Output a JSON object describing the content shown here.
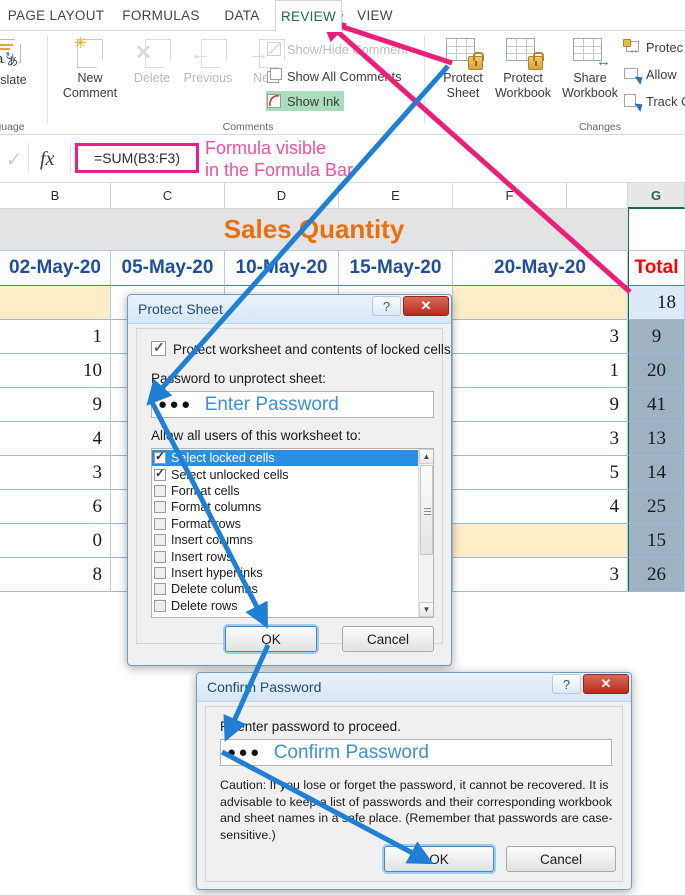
{
  "ribbon": {
    "tabs": [
      {
        "label": "PAGE LAYOUT",
        "active": false
      },
      {
        "label": "FORMULAS",
        "active": false
      },
      {
        "label": "DATA",
        "active": false
      },
      {
        "label": "REVIEW",
        "active": true
      },
      {
        "label": "VIEW",
        "active": false
      }
    ],
    "groups": {
      "language": {
        "label": "guage",
        "full_label": "Language"
      },
      "comments": {
        "label": "Comments"
      },
      "changes": {
        "label": "Changes"
      }
    },
    "language_buttons": [
      {
        "label": "nslate",
        "full_label": "Translate",
        "icon": "translate-icon",
        "disabled": false
      }
    ],
    "comment_buttons": [
      {
        "label": "New",
        "label2": "Comment",
        "icon": "new-comment-icon",
        "disabled": false
      },
      {
        "label": "Delete",
        "icon": "delete-comment-icon",
        "disabled": true
      },
      {
        "label": "Previous",
        "icon": "previous-comment-icon",
        "disabled": true
      },
      {
        "label": "Next",
        "icon": "next-comment-icon",
        "disabled": true
      }
    ],
    "comment_commands": [
      {
        "label": "Show/Hide Comment",
        "icon": "show-hide-comment-icon",
        "disabled": true,
        "highlight": false
      },
      {
        "label": "Show All Comments",
        "icon": "show-all-comments-icon",
        "disabled": false,
        "highlight": false
      },
      {
        "label": "Show Ink",
        "icon": "show-ink-icon",
        "disabled": false,
        "highlight": true
      }
    ],
    "changes_buttons": [
      {
        "label": "Protect",
        "label2": "Sheet",
        "icon": "protect-sheet-icon"
      },
      {
        "label": "Protect",
        "label2": "Workbook",
        "icon": "protect-workbook-icon"
      },
      {
        "label": "Share",
        "label2": "Workbook",
        "icon": "share-workbook-icon"
      }
    ],
    "changes_commands": [
      {
        "label": "Protec",
        "full_label": "Protect and Share Workbook",
        "icon": "protect-share-workbook-icon"
      },
      {
        "label": "Allow",
        "full_label": "Allow Users to Edit Ranges",
        "icon": "allow-users-icon"
      },
      {
        "label": "Track C",
        "full_label": "Track Changes",
        "icon": "track-changes-icon"
      }
    ]
  },
  "formula_bar": {
    "accept_icon": "checkmark-icon",
    "fx_icon": "fx-icon",
    "formula": "=SUM(B3:F3)",
    "annotation_line1": "Formula visible",
    "annotation_line2": "in the Formula Bar",
    "highlight_color": "#ec1e8b"
  },
  "sheet": {
    "column_headers": [
      {
        "label": "B",
        "selected": false
      },
      {
        "label": "C",
        "selected": false
      },
      {
        "label": "D",
        "selected": false
      },
      {
        "label": "E",
        "selected": false
      },
      {
        "label": "F",
        "selected": false
      },
      {
        "label": "G",
        "selected": true
      }
    ],
    "title": "Sales Quantity",
    "title_color": "#e8700d",
    "date_headers": [
      "02-May-20",
      "05-May-20",
      "10-May-20",
      "15-May-20",
      "20-May-20"
    ],
    "total_header": "Total",
    "date_header_color": "#1f4e9c",
    "total_header_color": "#ff0000",
    "rows": [
      {
        "b": "",
        "c": "",
        "d": "",
        "e": "",
        "f": "",
        "total": "18",
        "b_beige": true,
        "f_beige": true,
        "total_first": true
      },
      {
        "b": "1",
        "c": "",
        "d": "",
        "e": "",
        "f": "3",
        "total": "9"
      },
      {
        "b": "10",
        "c": "",
        "d": "",
        "e": "",
        "f": "1",
        "total": "20"
      },
      {
        "b": "9",
        "c": "",
        "d": "",
        "e": "",
        "f": "9",
        "total": "41"
      },
      {
        "b": "4",
        "c": "",
        "d": "",
        "e": "",
        "f": "3",
        "total": "13"
      },
      {
        "b": "3",
        "c": "",
        "d": "",
        "e": "",
        "f": "5",
        "total": "14"
      },
      {
        "b": "6",
        "c": "",
        "d": "",
        "e": "",
        "f": "4",
        "total": "25"
      },
      {
        "b": "0",
        "c": "",
        "d": "",
        "e": "",
        "f": "",
        "total": "15",
        "f_beige": true
      },
      {
        "b": "8",
        "c": "",
        "d": "",
        "e": "",
        "f": "3",
        "total": "26"
      }
    ]
  },
  "protect_sheet_dialog": {
    "title": "Protect Sheet",
    "help_button": "?",
    "close_button": "✕",
    "checkbox_label": "Protect worksheet and contents of locked cells",
    "checkbox_checked": true,
    "password_label": "Password to unprotect sheet:",
    "password_dots": "●●●",
    "password_annotation": "Enter Password",
    "allow_label": "Allow all users of this worksheet to:",
    "permissions": [
      {
        "label": "Select locked cells",
        "checked": true,
        "selected": true
      },
      {
        "label": "Select unlocked cells",
        "checked": true,
        "selected": false
      },
      {
        "label": "Format cells",
        "checked": false,
        "selected": false
      },
      {
        "label": "Format columns",
        "checked": false,
        "selected": false
      },
      {
        "label": "Format rows",
        "checked": false,
        "selected": false
      },
      {
        "label": "Insert columns",
        "checked": false,
        "selected": false
      },
      {
        "label": "Insert rows",
        "checked": false,
        "selected": false
      },
      {
        "label": "Insert hyperlinks",
        "checked": false,
        "selected": false
      },
      {
        "label": "Delete columns",
        "checked": false,
        "selected": false
      },
      {
        "label": "Delete rows",
        "checked": false,
        "selected": false
      }
    ],
    "ok_label": "OK",
    "cancel_label": "Cancel"
  },
  "confirm_password_dialog": {
    "title": "Confirm Password",
    "help_button": "?",
    "close_button": "✕",
    "reenter_label": "Reenter password to proceed.",
    "password_dots": "●●●",
    "password_annotation": "Confirm Password",
    "caution_text": "Caution: If you lose or forget the password, it cannot be recovered. It is advisable to keep a list of passwords and their corresponding workbook and sheet names in a safe place.  (Remember that passwords are case-sensitive.)",
    "ok_label": "OK",
    "cancel_label": "Cancel"
  },
  "annotations": {
    "pink_color": "#ed1e79",
    "blue_color": "#1f7fd4",
    "pink_arrows": [
      {
        "from": "protect-sheet-ribbon-button",
        "to": "review-tab"
      },
      {
        "from": "total-column-g",
        "to": "review-tab"
      }
    ],
    "blue_arrows": [
      {
        "from": "protect-sheet-ribbon-button",
        "to": "protect-sheet-password-field"
      },
      {
        "from": "protect-sheet-password-field",
        "to": "protect-sheet-ok-button"
      },
      {
        "from": "protect-sheet-ok-button",
        "to": "confirm-password-field"
      },
      {
        "from": "confirm-password-field",
        "to": "confirm-password-ok-button"
      }
    ]
  }
}
